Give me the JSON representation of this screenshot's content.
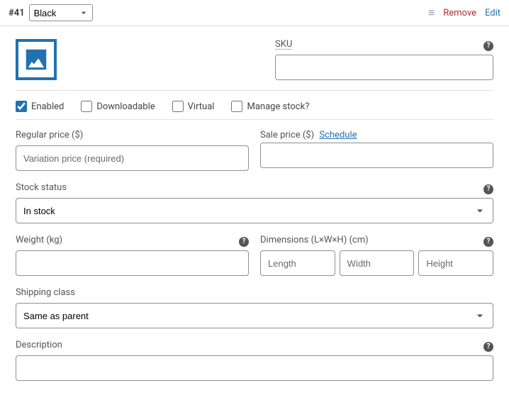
{
  "header": {
    "variation_id": "#41",
    "attribute_value": "Black",
    "remove": "Remove",
    "edit": "Edit"
  },
  "sku": {
    "label": "SKU",
    "value": ""
  },
  "checkboxes": {
    "enabled": {
      "label": "Enabled",
      "checked": true
    },
    "downloadable": {
      "label": "Downloadable",
      "checked": false
    },
    "virtual": {
      "label": "Virtual",
      "checked": false
    },
    "manage_stock": {
      "label": "Manage stock?",
      "checked": false
    }
  },
  "pricing": {
    "regular": {
      "label": "Regular price ($)",
      "placeholder": "Variation price (required)",
      "value": ""
    },
    "sale": {
      "label": "Sale price ($)",
      "schedule": "Schedule",
      "value": ""
    }
  },
  "stock": {
    "label": "Stock status",
    "value": "In stock"
  },
  "weight": {
    "label": "Weight (kg)",
    "value": ""
  },
  "dimensions": {
    "label": "Dimensions (L×W×H) (cm)",
    "length": {
      "placeholder": "Length",
      "value": ""
    },
    "width": {
      "placeholder": "Width",
      "value": ""
    },
    "height": {
      "placeholder": "Height",
      "value": ""
    }
  },
  "shipping": {
    "label": "Shipping class",
    "value": "Same as parent"
  },
  "description": {
    "label": "Description"
  },
  "help_glyph": "?"
}
